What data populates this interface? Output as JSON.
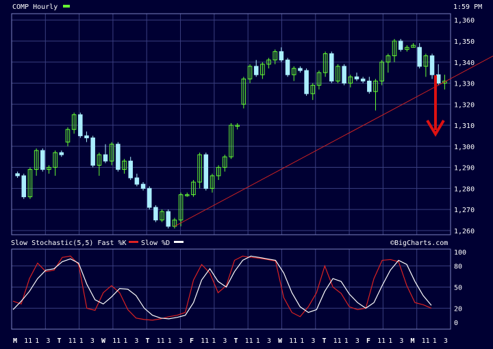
{
  "header": {
    "title": "COMP Hourly",
    "time": "1:59 PM",
    "legend_color": "#66ff33"
  },
  "colors": {
    "background": "#000033",
    "grid": "#3a3f80",
    "candle_up": "#66ff33",
    "candle_down": "#aaeeff",
    "trendline": "#cc2222",
    "arrow": "#dd1111",
    "fast_k": "#dd2222",
    "slow_d": "#ffffff"
  },
  "chart_data": [
    {
      "type": "candlestick",
      "title": "COMP Hourly",
      "ylim": [
        1258,
        1363
      ],
      "yticks": [
        "1,260",
        "1,270",
        "1,280",
        "1,290",
        "1,300",
        "1,310",
        "1,320",
        "1,330",
        "1,340",
        "1,350",
        "1,360"
      ],
      "ytick_values": [
        1260,
        1270,
        1280,
        1290,
        1300,
        1310,
        1320,
        1330,
        1340,
        1350,
        1360
      ],
      "candles": [
        [
          1287,
          1288,
          1285,
          1286
        ],
        [
          1286,
          1287,
          1275,
          1276
        ],
        [
          1276,
          1290,
          1275,
          1289
        ],
        [
          1289,
          1299,
          1286,
          1298
        ],
        [
          1298,
          1299,
          1288,
          1289
        ],
        [
          1289,
          1291,
          1287,
          1290
        ],
        [
          1290,
          1298,
          1286,
          1297
        ],
        [
          1297,
          1298,
          1295,
          1296
        ],
        [
          1302,
          1309,
          1300,
          1308
        ],
        [
          1308,
          1316,
          1306,
          1315
        ],
        [
          1315,
          1316,
          1304,
          1305
        ],
        [
          1305,
          1307,
          1302,
          1304
        ],
        [
          1304,
          1305,
          1290,
          1291
        ],
        [
          1291,
          1297,
          1286,
          1296
        ],
        [
          1296,
          1301,
          1292,
          1293
        ],
        [
          1293,
          1302,
          1291,
          1301
        ],
        [
          1301,
          1302,
          1288,
          1289
        ],
        [
          1289,
          1294,
          1287,
          1293
        ],
        [
          1293,
          1295,
          1284,
          1285
        ],
        [
          1285,
          1287,
          1281,
          1282
        ],
        [
          1282,
          1283,
          1279,
          1280
        ],
        [
          1280,
          1281,
          1270,
          1271
        ],
        [
          1271,
          1272,
          1264,
          1265
        ],
        [
          1265,
          1270,
          1264,
          1269
        ],
        [
          1269,
          1270,
          1261,
          1262
        ],
        [
          1262,
          1266,
          1261,
          1265
        ],
        [
          1265,
          1278,
          1262,
          1277
        ],
        [
          1277,
          1278,
          1276,
          1277
        ],
        [
          1277,
          1284,
          1276,
          1283
        ],
        [
          1283,
          1297,
          1280,
          1296
        ],
        [
          1296,
          1297,
          1279,
          1280
        ],
        [
          1280,
          1287,
          1278,
          1286
        ],
        [
          1286,
          1291,
          1284,
          1290
        ],
        [
          1290,
          1296,
          1288,
          1295
        ],
        [
          1295,
          1311,
          1294,
          1310
        ],
        [
          1310,
          1311,
          1308,
          1310
        ],
        [
          1320,
          1333,
          1318,
          1332
        ],
        [
          1332,
          1339,
          1330,
          1338
        ],
        [
          1338,
          1341,
          1333,
          1334
        ],
        [
          1334,
          1340,
          1332,
          1339
        ],
        [
          1339,
          1342,
          1337,
          1341
        ],
        [
          1341,
          1346,
          1339,
          1345
        ],
        [
          1345,
          1347,
          1340,
          1341
        ],
        [
          1341,
          1342,
          1333,
          1334
        ],
        [
          1334,
          1338,
          1331,
          1337
        ],
        [
          1337,
          1338,
          1335,
          1336
        ],
        [
          1336,
          1337,
          1324,
          1325
        ],
        [
          1325,
          1330,
          1322,
          1329
        ],
        [
          1329,
          1336,
          1327,
          1335
        ],
        [
          1335,
          1345,
          1333,
          1344
        ],
        [
          1344,
          1345,
          1330,
          1331
        ],
        [
          1331,
          1339,
          1330,
          1338
        ],
        [
          1338,
          1339,
          1329,
          1330
        ],
        [
          1330,
          1334,
          1328,
          1333
        ],
        [
          1333,
          1335,
          1331,
          1332
        ],
        [
          1332,
          1333,
          1330,
          1331
        ],
        [
          1331,
          1333,
          1325,
          1326
        ],
        [
          1326,
          1332,
          1317,
          1331
        ],
        [
          1331,
          1341,
          1329,
          1340
        ],
        [
          1340,
          1344,
          1335,
          1343
        ],
        [
          1343,
          1351,
          1340,
          1350
        ],
        [
          1350,
          1351,
          1345,
          1346
        ],
        [
          1346,
          1348,
          1345,
          1347
        ],
        [
          1347,
          1349,
          1347,
          1348
        ],
        [
          1347,
          1349,
          1337,
          1338
        ],
        [
          1338,
          1344,
          1333,
          1343
        ],
        [
          1343,
          1344,
          1332,
          1334
        ],
        [
          1334,
          1339,
          1329,
          1330
        ],
        [
          1330,
          1334,
          1327,
          1331
        ]
      ],
      "trendline": {
        "from": [
          25,
          1262
        ],
        "to": [
          74,
          1340
        ]
      },
      "annotation": "downward arrow"
    },
    {
      "type": "line",
      "title": "Slow Stochastic(5,5) Fast %K  Slow %D",
      "credit": "©BigCharts.com",
      "ylim": [
        0,
        100
      ],
      "yticks": [
        "100",
        "80",
        "50",
        "20",
        "0"
      ],
      "ytick_values": [
        100,
        80,
        50,
        20,
        0
      ],
      "x_labels": [
        "M",
        "11",
        "1",
        "3",
        "T",
        "11",
        "1",
        "3",
        "W",
        "11",
        "1",
        "3",
        "T",
        "11",
        "1",
        "3",
        "F",
        "11",
        "1",
        "3",
        "T",
        "11",
        "1",
        "3",
        "W",
        "11",
        "1",
        "3",
        "T",
        "11",
        "1",
        "3",
        "F",
        "11",
        "1",
        "3",
        "M",
        "11",
        "1",
        "3"
      ],
      "series": [
        {
          "name": "Fast %K",
          "values": [
            30,
            26,
            62,
            84,
            72,
            74,
            92,
            94,
            82,
            20,
            17,
            42,
            52,
            42,
            18,
            6,
            4,
            3,
            5,
            8,
            10,
            14,
            60,
            82,
            70,
            42,
            52,
            88,
            94,
            92,
            91,
            89,
            87,
            35,
            14,
            8,
            22,
            42,
            80,
            50,
            41,
            22,
            18,
            20,
            62,
            88,
            89,
            86,
            52,
            28,
            25,
            20
          ]
        },
        {
          "name": "Slow %D",
          "values": [
            18,
            30,
            44,
            62,
            74,
            76,
            86,
            90,
            84,
            54,
            32,
            26,
            36,
            48,
            47,
            38,
            20,
            10,
            6,
            5,
            7,
            10,
            28,
            60,
            76,
            58,
            50,
            72,
            88,
            94,
            92,
            90,
            88,
            70,
            42,
            22,
            14,
            18,
            44,
            62,
            58,
            40,
            28,
            20,
            28,
            52,
            74,
            88,
            82,
            58,
            38,
            24
          ]
        }
      ]
    }
  ]
}
